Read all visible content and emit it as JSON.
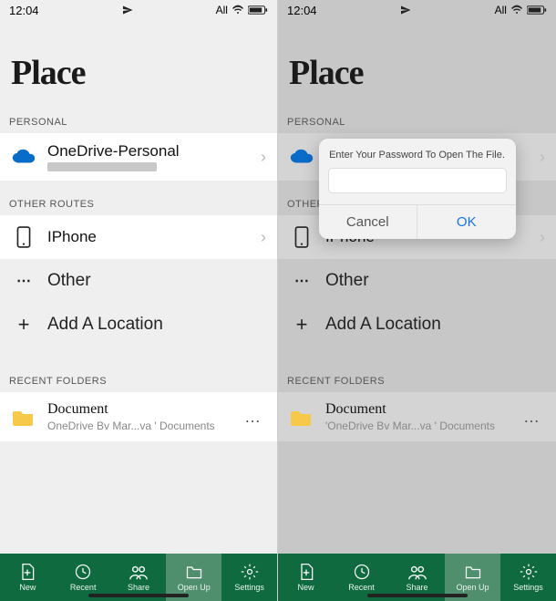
{
  "statusbar": {
    "time": "12:04",
    "net": "All"
  },
  "title": "Place",
  "sections": {
    "personal": "PERSONAL",
    "other_routes": "OTHER ROUTES",
    "other_routes_r": "OTHER",
    "recent": "RECENT FOLDERS"
  },
  "rows": {
    "onedrive": {
      "label": "OneDrive-Personal"
    },
    "iphone": {
      "label": "IPhone"
    },
    "other": {
      "label": "Other"
    },
    "add": {
      "label": "Add A Location"
    },
    "doc": {
      "label": "Document",
      "sublabel": "OneDrive Bv Mar...va ' Documents"
    },
    "doc_r_sub": "'OneDrive Bv Mar...va ' Documents"
  },
  "tabs": {
    "new": "New",
    "recent": "Recent",
    "share": "Share",
    "open": "Open Up",
    "settings": "Settings"
  },
  "dialog": {
    "message": "Enter Your Password To Open The File.",
    "cancel": "Cancel",
    "ok": "OK"
  }
}
